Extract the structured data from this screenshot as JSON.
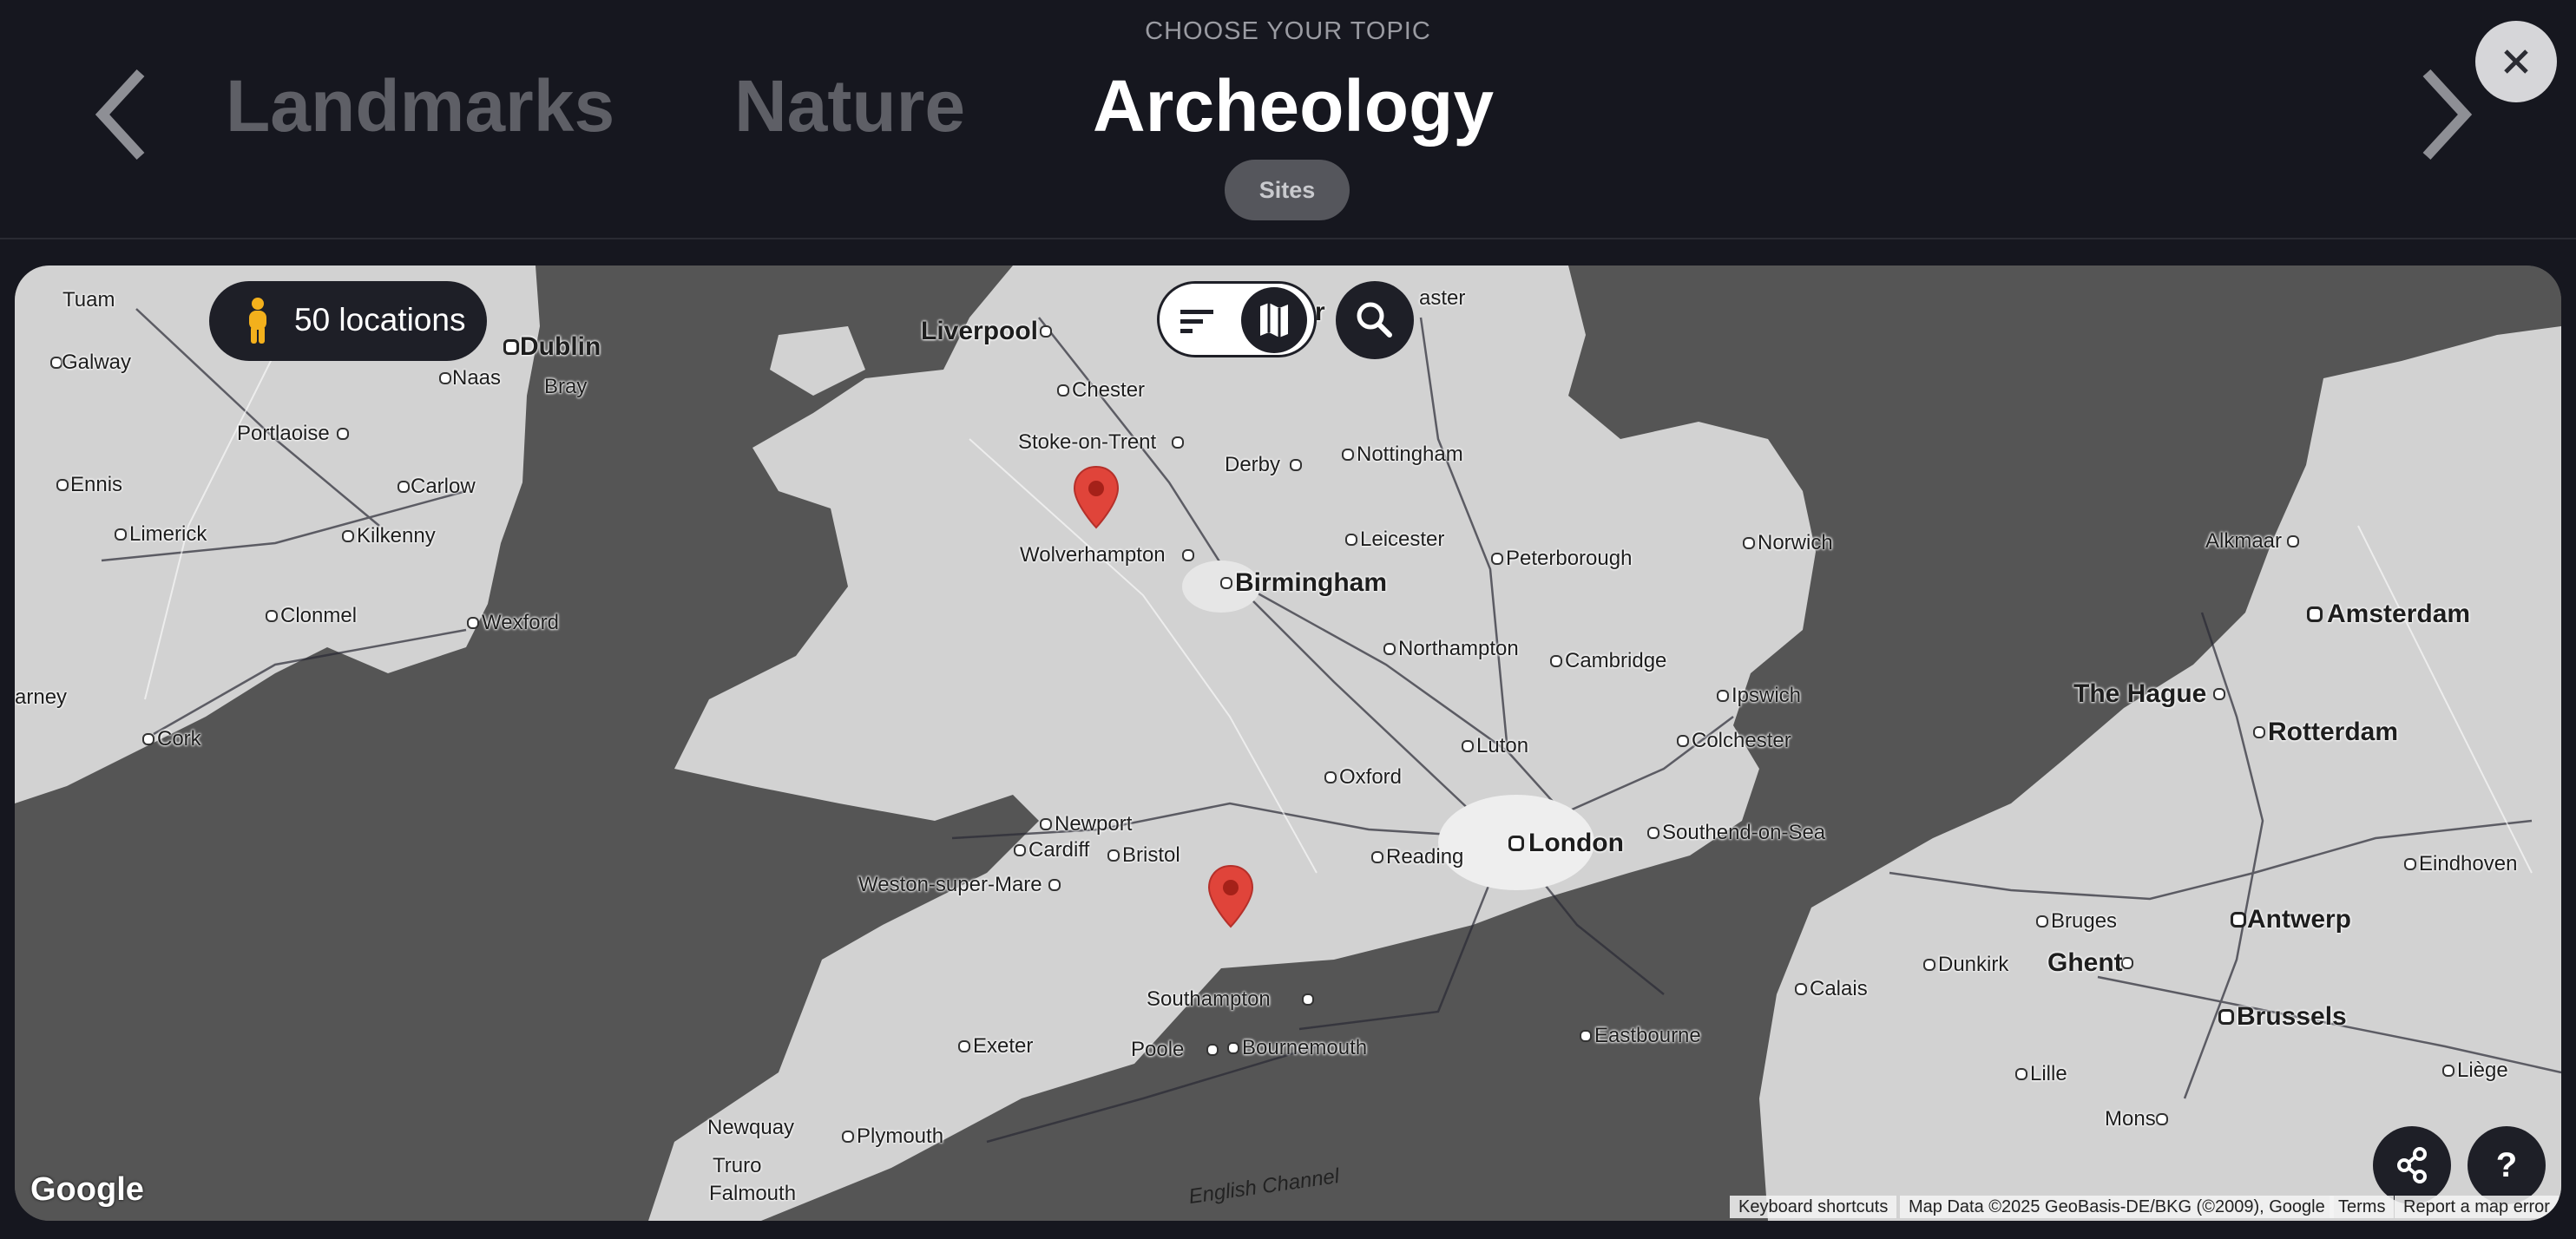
{
  "header": {
    "kicker": "CHOOSE YOUR TOPIC",
    "topics": [
      "Landmarks",
      "Nature",
      "Archeology"
    ],
    "active_topic": "Archeology",
    "subtopic": "Sites"
  },
  "map": {
    "locations_label": "50 locations",
    "cities": {
      "tuam": "Tuam",
      "galway": "Galway",
      "dublin": "Dublin",
      "naas": "Naas",
      "bray": "Bray",
      "portlaoise": "Portlaoise",
      "ennis": "Ennis",
      "carlow": "Carlow",
      "limerick": "Limerick",
      "kilkenny": "Kilkenny",
      "clonmel": "Clonmel",
      "wexford": "Wexford",
      "tralee": "arney",
      "cork": "Cork",
      "liverpool": "Liverpool",
      "chester": "Chester",
      "manchester": "r",
      "leicester_top": "aster",
      "stoke": "Stoke-on-Trent",
      "derby": "Derby",
      "nottingham": "Nottingham",
      "wolverhampton": "Wolverhampton",
      "birmingham": "Birmingham",
      "leicester": "Leicester",
      "peterborough": "Peterborough",
      "norwich": "Norwich",
      "northampton": "Northampton",
      "cambridge": "Cambridge",
      "ipswich": "Ipswich",
      "luton": "Luton",
      "colchester": "Colchester",
      "oxford": "Oxford",
      "newport": "Newport",
      "cardiff": "Cardiff",
      "bristol": "Bristol",
      "weston": "Weston-super-Mare",
      "reading": "Reading",
      "london": "London",
      "southend": "Southend-on-Sea",
      "southampton": "Southampton",
      "exeter": "Exeter",
      "poole": "Poole",
      "bournemouth": "Bournemouth",
      "eastbourne": "Eastbourne",
      "newquay": "Newquay",
      "plymouth": "Plymouth",
      "truro": "Truro",
      "falmouth": "Falmouth",
      "english_channel": "English Channel",
      "alkmaar": "Alkmaar",
      "amsterdam": "Amsterdam",
      "the_hague": "The Hague",
      "rotterdam": "Rotterdam",
      "eindhoven": "Eindhoven",
      "bruges": "Bruges",
      "antwerp": "Antwerp",
      "ghent": "Ghent",
      "dunkirk": "Dunkirk",
      "calais": "Calais",
      "brussels": "Brussels",
      "lille": "Lille",
      "liege": "Liège",
      "mons": "Mons"
    },
    "logo": "Google",
    "attribution": {
      "shortcuts": "Keyboard shortcuts",
      "data": "Map Data ©2025 GeoBasis-DE/BKG (©2009), Google",
      "terms": "Terms",
      "report": "Report a map error"
    },
    "help_label": "?"
  },
  "colors": {
    "background": "#16171f",
    "land": "#d2d2d2",
    "sea": "#555555",
    "pin": "#e0443a",
    "accent_figure": "#f3b01c"
  },
  "icons": {
    "prev": "chevron-left-icon",
    "next": "chevron-right-icon",
    "close": "close-icon",
    "pegman": "pegman-icon",
    "sort": "sort-icon",
    "map": "map-icon",
    "search": "search-icon",
    "share": "share-icon",
    "help": "help-icon",
    "pin": "map-pin-icon"
  }
}
